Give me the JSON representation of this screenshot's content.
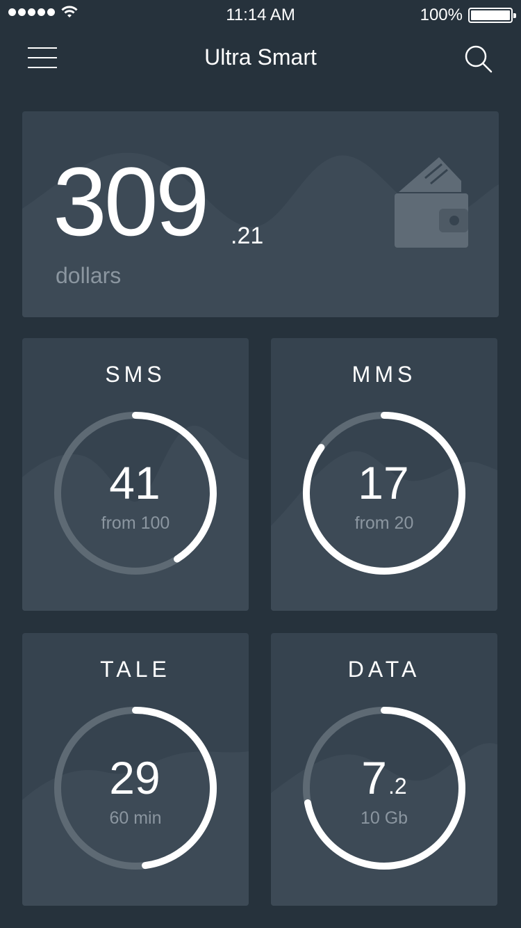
{
  "status_bar": {
    "time": "11:14 AM",
    "battery_text": "100%"
  },
  "header": {
    "title": "Ultra Smart"
  },
  "balance": {
    "integer": "309",
    "decimal": ".21",
    "unit": "dollars"
  },
  "cards": [
    {
      "title": "SMS",
      "value": "41",
      "value_decimal": "",
      "subtitle": "from 100",
      "progress": 0.41
    },
    {
      "title": "MMS",
      "value": "17",
      "value_decimal": "",
      "subtitle": "from 20",
      "progress": 0.85
    },
    {
      "title": "TALE",
      "value": "29",
      "value_decimal": "",
      "subtitle": "60 min",
      "progress": 0.48
    },
    {
      "title": "DATA",
      "value": "7",
      "value_decimal": ".2",
      "subtitle": "10 Gb",
      "progress": 0.72
    }
  ],
  "colors": {
    "background": "#26323c",
    "card": "#36434f",
    "track": "#5e6a74",
    "progress": "#ffffff",
    "muted_text": "#8b96a0"
  },
  "icons": {
    "menu": "hamburger-menu-icon",
    "search": "search-icon",
    "wallet": "wallet-icon",
    "wifi": "wifi-icon",
    "battery": "battery-icon"
  }
}
